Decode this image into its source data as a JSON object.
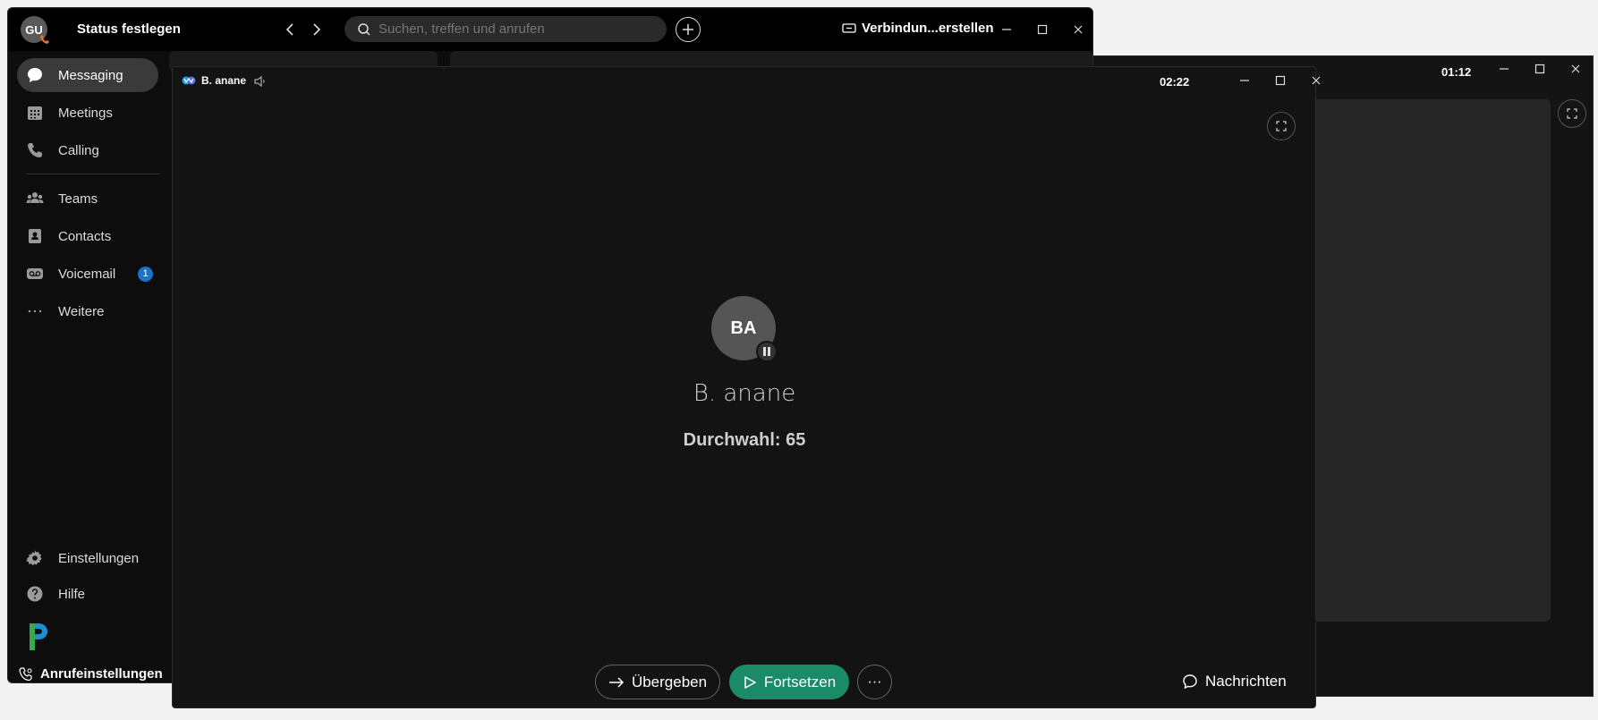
{
  "back_window": {
    "timer": "01:12"
  },
  "main": {
    "avatar_initials": "GU",
    "status_label": "Status festlegen",
    "search_placeholder": "Suchen, treffen und anrufen",
    "connect_label": "Verbindun...erstellen"
  },
  "sidebar": {
    "items": [
      {
        "label": "Messaging",
        "icon": "chat-bubble-icon",
        "active": true
      },
      {
        "label": "Meetings",
        "icon": "calendar-icon"
      },
      {
        "label": "Calling",
        "icon": "phone-icon"
      },
      {
        "label": "Teams",
        "icon": "people-icon"
      },
      {
        "label": "Contacts",
        "icon": "contacts-icon"
      },
      {
        "label": "Voicemail",
        "icon": "voicemail-icon",
        "badge": "1"
      },
      {
        "label": "Weitere",
        "icon": "more-horizontal-icon"
      }
    ],
    "settings_label": "Einstellungen",
    "help_label": "Hilfe",
    "call_settings_label": "Anrufeinstellungen"
  },
  "call": {
    "window_title": "B. anane",
    "timer": "02:22",
    "avatar_initials": "BA",
    "caller_name": "B. anane",
    "extension": "Durchwahl: 65",
    "transfer_label": "Übergeben",
    "resume_label": "Fortsetzen",
    "more_label": "···",
    "messages_label": "Nachrichten"
  },
  "colors": {
    "accent_green": "#1b8a66",
    "badge_blue": "#1a73c8",
    "background": "#131313"
  }
}
